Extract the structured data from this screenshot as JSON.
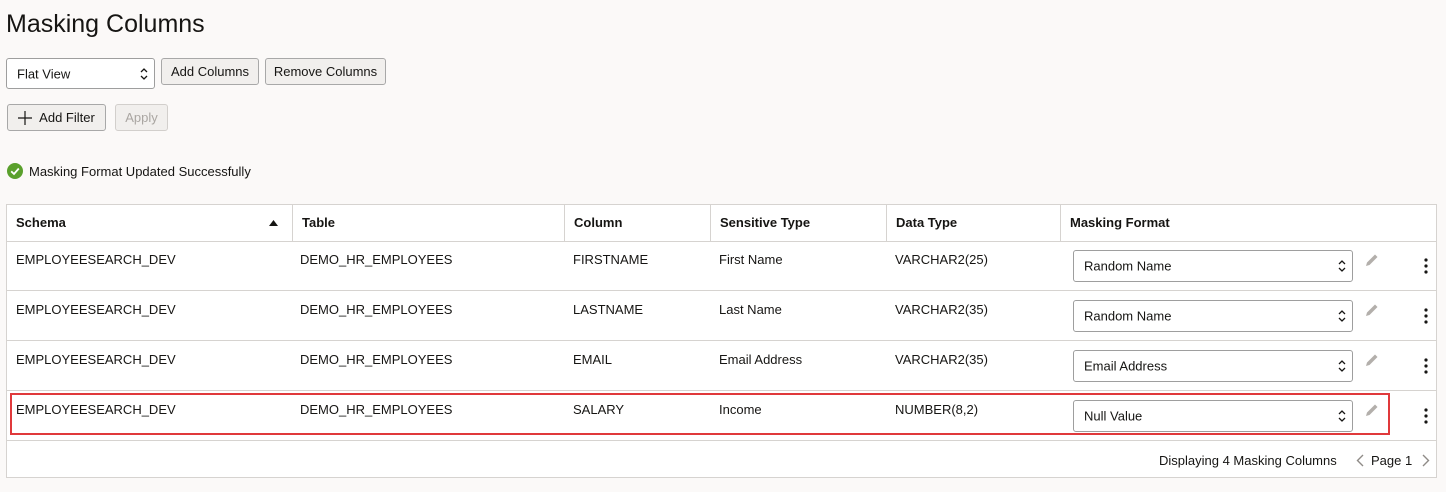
{
  "page": {
    "title": "Masking Columns"
  },
  "toolbar": {
    "view_select": "Flat View",
    "add_columns_label": "Add Columns",
    "remove_columns_label": "Remove Columns"
  },
  "filter": {
    "add_filter_label": "Add Filter",
    "apply_label": "Apply"
  },
  "status": {
    "message": "Masking Format Updated Successfully",
    "color": "#5aa02c"
  },
  "table": {
    "headers": [
      "Schema",
      "Table",
      "Column",
      "Sensitive Type",
      "Data Type",
      "Masking Format"
    ],
    "rows": [
      {
        "schema": "EMPLOYEESEARCH_DEV",
        "table": "DEMO_HR_EMPLOYEES",
        "column": "FIRSTNAME",
        "sensitive_type": "First Name",
        "data_type": "VARCHAR2(25)",
        "masking_format": "Random Name"
      },
      {
        "schema": "EMPLOYEESEARCH_DEV",
        "table": "DEMO_HR_EMPLOYEES",
        "column": "LASTNAME",
        "sensitive_type": "Last Name",
        "data_type": "VARCHAR2(35)",
        "masking_format": "Random Name"
      },
      {
        "schema": "EMPLOYEESEARCH_DEV",
        "table": "DEMO_HR_EMPLOYEES",
        "column": "EMAIL",
        "sensitive_type": "Email Address",
        "data_type": "VARCHAR2(35)",
        "masking_format": "Email Address"
      },
      {
        "schema": "EMPLOYEESEARCH_DEV",
        "table": "DEMO_HR_EMPLOYEES",
        "column": "SALARY",
        "sensitive_type": "Income",
        "data_type": "NUMBER(8,2)",
        "masking_format": "Null Value"
      }
    ],
    "sort": {
      "column": "Schema",
      "direction": "ascending"
    }
  },
  "pagination": {
    "summary": "Displaying 4 Masking Columns",
    "page_label": "Page 1"
  },
  "colors": {
    "highlight": "#e0393b",
    "border": "#d6d3d0",
    "background": "#fbf9f8"
  },
  "icons": [
    "plus-icon",
    "check-circle-icon",
    "sort-ascending-icon",
    "chevron-updown-icon",
    "pencil-icon",
    "kebab-icon",
    "chevron-left-icon",
    "chevron-right-icon"
  ]
}
